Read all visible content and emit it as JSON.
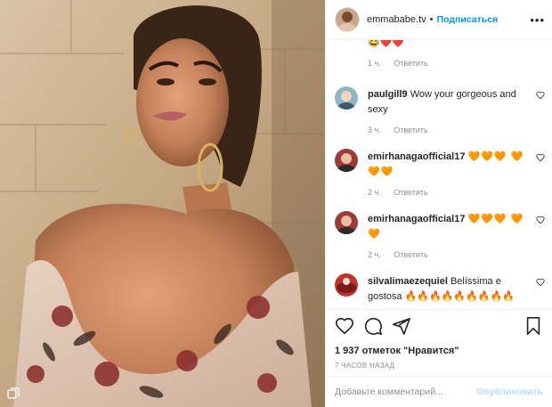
{
  "header": {
    "username": "emmababe.tv",
    "separator": "•",
    "follow_label": "Подписаться",
    "more_icon": "more-horizontal-icon"
  },
  "comments": [
    {
      "username": "",
      "text": "😂❤️❤️",
      "time": "1 ч.",
      "reply_label": "Ответить",
      "partial": true
    },
    {
      "username": "paulgill9",
      "text": "Wow your gorgeous and sexy",
      "time": "3 ч.",
      "reply_label": "Ответить"
    },
    {
      "username": "emirhanagaofficial17",
      "text": "🧡🧡🧡 🧡🧡🧡",
      "time": "2 ч.",
      "reply_label": "Ответить"
    },
    {
      "username": "emirhanagaofficial17",
      "text": "🧡🧡🧡 🧡🧡",
      "time": "2 ч.",
      "reply_label": "Ответить"
    },
    {
      "username": "silvalimaezequiel",
      "text": "Belíssima e gostosa 🔥🔥🔥🔥🔥🔥🔥🔥🔥",
      "time": "",
      "reply_label": ""
    }
  ],
  "actions": {
    "like_icon": "heart-icon",
    "comment_icon": "comment-icon",
    "share_icon": "share-icon",
    "save_icon": "bookmark-icon"
  },
  "likes_text": "1 937 отметок \"Нравится\"",
  "posted_time": "7 ЧАСОВ НАЗАД",
  "add_comment": {
    "placeholder": "Добавьте комментарий...",
    "publish_label": "Опубликовать"
  },
  "colors": {
    "accent": "#0095f6",
    "publish_disabled": "#b2dffc",
    "muted": "#8e8e8e"
  }
}
